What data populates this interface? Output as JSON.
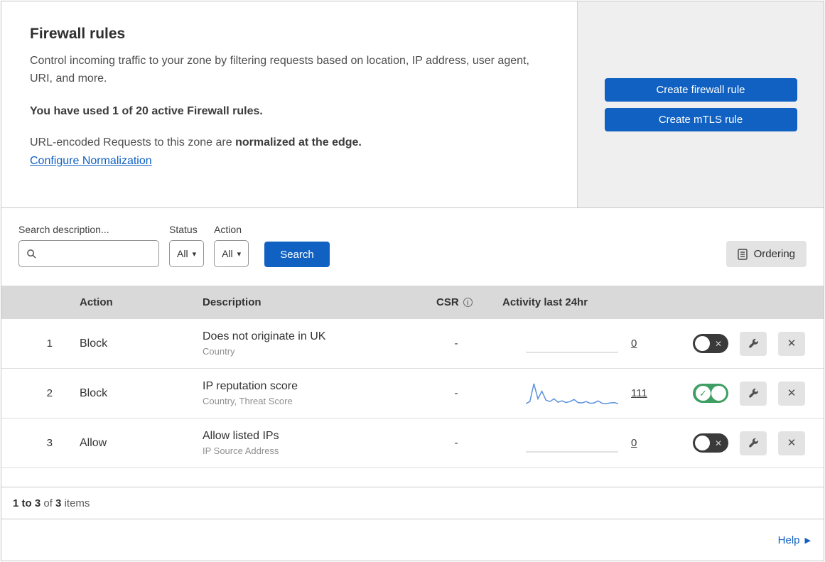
{
  "header": {
    "title": "Firewall rules",
    "description": "Control incoming traffic to your zone by filtering requests based on location, IP address, user agent, URI, and more.",
    "usage": "You have used 1 of 20 active Firewall rules.",
    "normalization_prefix": "URL-encoded Requests to this zone are ",
    "normalization_bold": "normalized at the edge.",
    "configure_link": "Configure Normalization",
    "create_firewall_button": "Create firewall rule",
    "create_mtls_button": "Create mTLS rule"
  },
  "filters": {
    "search_label": "Search description...",
    "search_value": "",
    "status_label": "Status",
    "status_value": "All",
    "action_label": "Action",
    "action_value": "All",
    "search_button": "Search",
    "ordering_button": "Ordering"
  },
  "table": {
    "headers": {
      "action": "Action",
      "description": "Description",
      "csr": "CSR",
      "activity": "Activity last 24hr"
    },
    "rows": [
      {
        "priority": "1",
        "action": "Block",
        "description": "Does not originate in UK",
        "fields": "Country",
        "csr": "-",
        "activity": "0",
        "enabled": false,
        "sparkline": null
      },
      {
        "priority": "2",
        "action": "Block",
        "description": "IP reputation score",
        "fields": "Country, Threat Score",
        "csr": "-",
        "activity": "111",
        "enabled": true,
        "sparkline": [
          4,
          10,
          62,
          18,
          40,
          14,
          10,
          18,
          8,
          12,
          7,
          10,
          16,
          7,
          6,
          10,
          5,
          6,
          12,
          5,
          4,
          6,
          7,
          4
        ]
      },
      {
        "priority": "3",
        "action": "Allow",
        "description": "Allow listed IPs",
        "fields": "IP Source Address",
        "csr": "-",
        "activity": "0",
        "enabled": false,
        "sparkline": null
      }
    ]
  },
  "footer": {
    "range": "1 to 3",
    "of": "of",
    "total": "3",
    "items": "items",
    "help": "Help"
  },
  "icons": {
    "caret": "▾",
    "info": "i",
    "check": "✓",
    "cross": "✕",
    "help_arrow": "▶"
  },
  "colors": {
    "accent": "#1061c2",
    "link": "#1061c2",
    "toggle_on": "#3f9e63",
    "toggle_off": "#3a3a3a",
    "sparkline": "#5b93dd",
    "flatline": "#d9d9d9",
    "table_header_bg": "#d9d9d9",
    "panel_bg": "#efefef"
  }
}
